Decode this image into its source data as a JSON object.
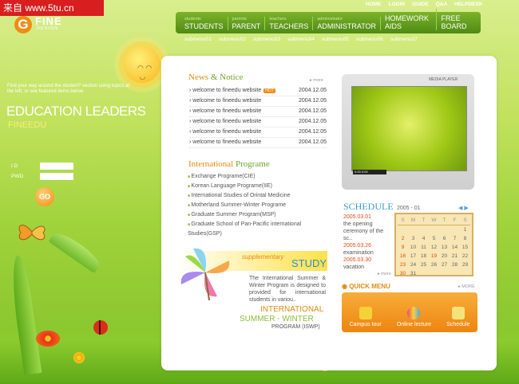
{
  "watermark": "来自 www.5tu.cn",
  "logo": {
    "letter": "G",
    "name": "FINE",
    "sub": "DESIGN"
  },
  "top_links": [
    "HOME",
    "LOGIN",
    "GUIDE",
    "Q&A",
    "HELPDESK"
  ],
  "nav": [
    {
      "small": "students",
      "big": "STUDENTS"
    },
    {
      "small": "parents",
      "big": "PARENT"
    },
    {
      "small": "teachers",
      "big": "TEACHERS"
    },
    {
      "small": "administrator",
      "big": "ADMINISTRATOR"
    },
    {
      "small": "homework aids",
      "big": "HOMEWORK AIDS"
    },
    {
      "small": "free board",
      "big": "FREE BOARD"
    }
  ],
  "submenu": [
    "submenu01",
    "submenu02",
    "submenu03",
    "submenu04",
    "submenu05",
    "submenu06",
    "submenu07"
  ],
  "left": {
    "intro": "Find your way around the student? section using topics at the left, or see featured items below",
    "headline": "EDUCATION LEADERS",
    "sub": "FINEEDU",
    "id_label": "I D",
    "pwd_label": "PWD",
    "go": "GO"
  },
  "news": {
    "title_a": "News",
    "title_b": " & Notice",
    "more": "more",
    "hot": "HOT",
    "items": [
      {
        "text": "welcome to fineedu website",
        "date": "2004.12.05",
        "hot": true
      },
      {
        "text": "welcome to fineedu website",
        "date": "2004.12.05",
        "hot": false
      },
      {
        "text": "welcome to fineedu website",
        "date": "2004.12.05",
        "hot": false
      },
      {
        "text": "welcome to fineedu website",
        "date": "2004.12.05",
        "hot": false
      },
      {
        "text": "welcome to fineedu website",
        "date": "2004.12.05",
        "hot": false
      },
      {
        "text": "welcome to fineedu website",
        "date": "2004.12.05",
        "hot": false
      }
    ]
  },
  "intl": {
    "title_a": "International",
    "title_b": " Programe",
    "items": [
      "Exchange Programe(CIE)",
      "Korean Language Programe(IIE)",
      "International Studies of Orintal Medicine",
      "Motherland Summer-Winter Programe",
      "Graduate Summer Program(MSP)",
      "Graduate School of Pan-Pacific international Studies(GSP)"
    ]
  },
  "media": {
    "label": "MEDIA PLAYER",
    "time": "0:00.0:00"
  },
  "schedule": {
    "title": "SCHEDULE",
    "month": "2005 - 01",
    "more": "more",
    "items": [
      {
        "date": "2005.03.01",
        "text": "the opening ceremony of the sc.."
      },
      {
        "date": "2005.03.26",
        "text": "examination"
      },
      {
        "date": "2005.03.30",
        "text": "vacation"
      }
    ],
    "days": [
      "S",
      "M",
      "T",
      "W",
      "T",
      "F",
      "S"
    ],
    "weeks": [
      [
        "",
        "",
        "",
        "",
        "",
        "",
        "1"
      ],
      [
        "2",
        "3",
        "4",
        "5",
        "6",
        "7",
        "8"
      ],
      [
        "9",
        "10",
        "11",
        "12",
        "13",
        "14",
        "15"
      ],
      [
        "16",
        "17",
        "18",
        "19",
        "20",
        "21",
        "22"
      ],
      [
        "23",
        "24",
        "25",
        "26",
        "27",
        "28",
        "29"
      ],
      [
        "30",
        "31",
        "",
        "",
        "",
        "",
        ""
      ]
    ]
  },
  "quick": {
    "title": "QUICK MENU",
    "more": "MORE",
    "items": [
      {
        "label": "Campus tour",
        "color": "#f5d23a"
      },
      {
        "label": "Online lecture",
        "color": "#e84a6a"
      },
      {
        "label": "Schedule",
        "color": "#f7e27a"
      }
    ]
  },
  "supplementary": {
    "title": "supplementary",
    "study": "STUDY",
    "text": "The International Summer & Winter Program is designed to provided for international students in variou..",
    "big1": "INTERNATIONAL",
    "big2": "SUMMER - WINTER",
    "big3": "PROGRAM (ISWP)"
  }
}
